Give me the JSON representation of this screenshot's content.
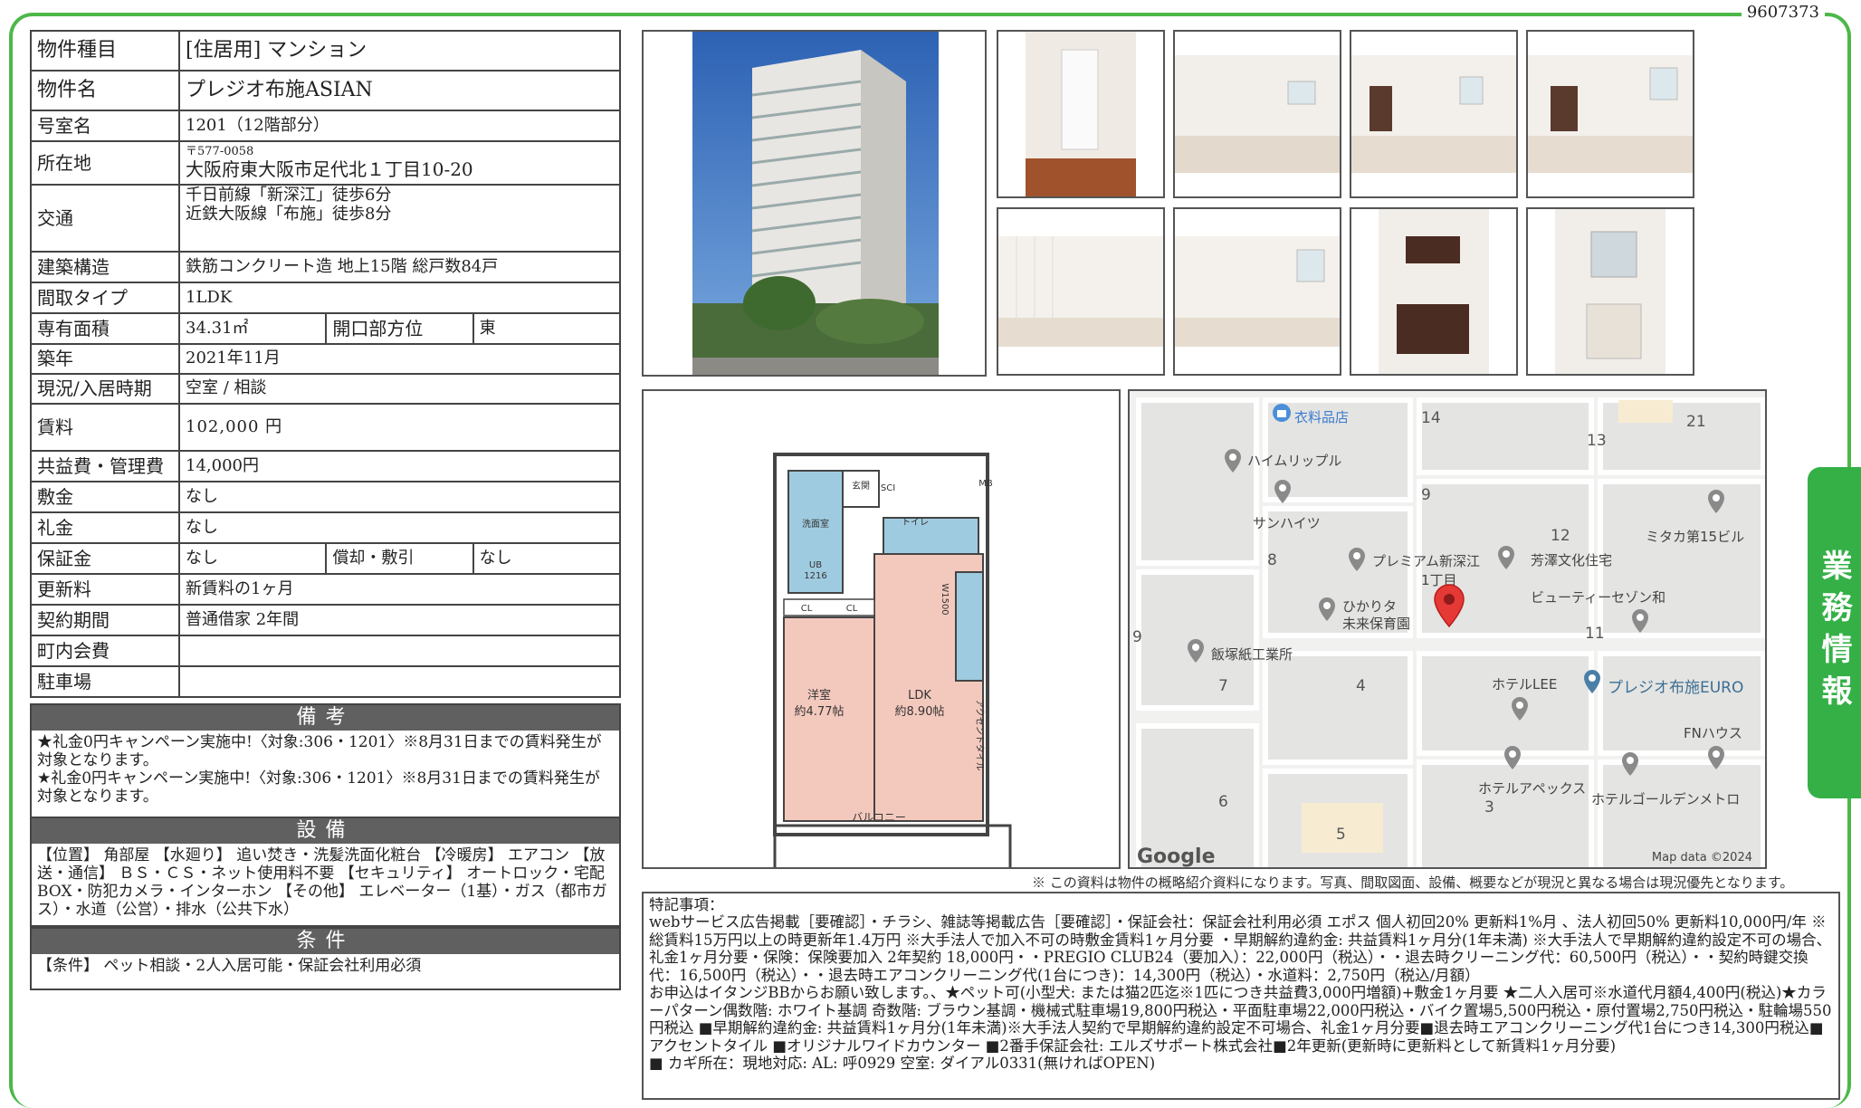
{
  "doc_id": "9607373",
  "side_tab": "業務情報",
  "info": {
    "type_label": "物件種目",
    "type_value": "[住居用] マンション",
    "name_label": "物件名",
    "name_value": "プレジオ布施ASIAN",
    "room_label": "号室名",
    "room_value": "1201（12階部分）",
    "addr_label": "所在地",
    "postal": "〒577-0058",
    "address": "大阪府東大阪市足代北１丁目10-20",
    "access_label": "交通",
    "access1": "千日前線「新深江」徒歩6分",
    "access2": "近鉄大阪線「布施」徒歩8分",
    "structure_label": "建築構造",
    "structure_value": "鉄筋コンクリート造 地上15階 総戸数84戸",
    "layout_label": "間取タイプ",
    "layout_value": "1LDK",
    "area_label": "専有面積",
    "area_value": "34.31㎡",
    "direction_label": "開口部方位",
    "direction_value": "東",
    "built_label": "築年",
    "built_value": "2021年11月",
    "status_label": "現況/入居時期",
    "status_value": "空室 / 相談",
    "rent_label": "賃料",
    "rent_value": "102,000 円",
    "fee_label": "共益費・管理費",
    "fee_value": "14,000円",
    "deposit_label": "敷金",
    "deposit_value": "なし",
    "key_label": "礼金",
    "key_value": "なし",
    "guarantee_label": "保証金",
    "guarantee_value": "なし",
    "amort_label": "償却・敷引",
    "amort_value": "なし",
    "renewal_label": "更新料",
    "renewal_value": "新賃料の1ヶ月",
    "contract_label": "契約期間",
    "contract_value": "普通借家 2年間",
    "town_label": "町内会費",
    "town_value": "",
    "parking_label": "駐車場",
    "parking_value": ""
  },
  "remarks": {
    "title": "備考",
    "text": "★礼金0円キャンペーン実施中!〈対象:306・1201〉※8月31日までの賃料発生が対象となります。\n★礼金0円キャンペーン実施中!〈対象:306・1201〉※8月31日までの賃料発生が対象となります。"
  },
  "equipment": {
    "title": "設備",
    "text": "【位置】 角部屋 【水廻り】 追い焚き・洗髪洗面化粧台 【冷暖房】 エアコン 【放送・通信】 ＢＳ・ＣＳ・ネット使用料不要 【セキュリティ】 オートロック・宅配BOX・防犯カメラ・インターホン 【その他】 エレベーター（1基）・ガス（都市ガス）・水道（公営）・排水（公共下水）"
  },
  "conditions": {
    "title": "条件",
    "text": "【条件】 ペット相談・2人入居可能・保証会社利用必須"
  },
  "floorplan": {
    "room_western": "洋室",
    "room_western_size": "約4.77帖",
    "room_ldk": "LDK",
    "room_ldk_size": "約8.90帖",
    "balcony": "バルコニー",
    "entrance": "玄関",
    "toilet": "トイレ",
    "washroom": "洗面室",
    "ub": "UB",
    "ub_size": "1216",
    "mb": "MB",
    "cl": "CL",
    "sci": "SCI",
    "accent": "アクセントタイル",
    "w1500": "W1500"
  },
  "map": {
    "labels": [
      "衣料品店",
      "ハイムリップル",
      "サンハイツ",
      "プレミアム新深江",
      "1丁目",
      "ひかりタ",
      "未来保育園",
      "芳澤文化住宅",
      "ミタカ第15ビル",
      "ビューティーセゾン和",
      "飯塚紙工業所",
      "ホテルLEE",
      "プレジオ布施EURO",
      "FNハウス",
      "ホテルアペックス",
      "ホテルゴールデンメトロ"
    ],
    "block_numbers": [
      "14",
      "13",
      "21",
      "9",
      "12",
      "8",
      "11",
      "9",
      "7",
      "4",
      "6",
      "3",
      "5"
    ],
    "google": "Google",
    "credit": "Map data ©2024"
  },
  "disclaimer": "※ この資料は物件の概略紹介資料になります。写真、間取図面、設備、概要などが現況と異なる場合は現況優先となります。",
  "notes": {
    "title": "特記事項：",
    "p1": "webサービス広告掲載［要確認］・チラシ、雑誌等掲載広告［要確認］・保証会社：保証会社利用必須 エポス 個人初回20% 更新料1%月 、法人初回50% 更新料10,000円/年 ※総賃料15万円以上の時更新年1.4万円 ※大手法人で加入不可の時敷金賃料1ヶ月分要 ・早期解約違約金: 共益賃料1ヶ月分(1年未満) ※大手法人で早期解約違約設定不可の場合、礼金1ヶ月分要・保険：保険要加入 2年契約 18,000円・・PREGIO CLUB24（要加入）：22,000円（税込）・・退去時クリーニング代：60,500円（税込）・・契約時鍵交換代：16,500円（税込）・・退去時エアコンクリーニング代(1台につき)：14,300円（税込）・水道料：2,750円（税込/月額）",
    "p2": "お申込はイタンジBBからお願い致します。、★ペット可(小型犬: または猫2匹迄※1匹につき共益費3,000円増額)+敷金1ヶ月要 ★二人入居可※水道代月額4,400円(税込)★カラーパターン偶数階: ホワイト基調 奇数階: ブラウン基調・機械式駐車場19,800円税込・平面駐車場22,000円税込・バイク置場5,500円税込・原付置場2,750円税込・駐輪場550円税込 ■早期解約違約金: 共益賃料1ヶ月分(1年未満)※大手法人契約で早期解約違約設定不可場合、礼金1ヶ月分要■退去時エアコンクリーニング代1台につき14,300円税込■アクセントタイル ■オリジナルワイドカウンター ■2番手保証会社: エルズサポート株式会社■2年更新(更新時に更新料として新賃料1ヶ月分要)",
    "p3": "■ カギ所在：現地対応: AL: 呼0929 空室: ダイアル0331(無ければOPEN)"
  }
}
